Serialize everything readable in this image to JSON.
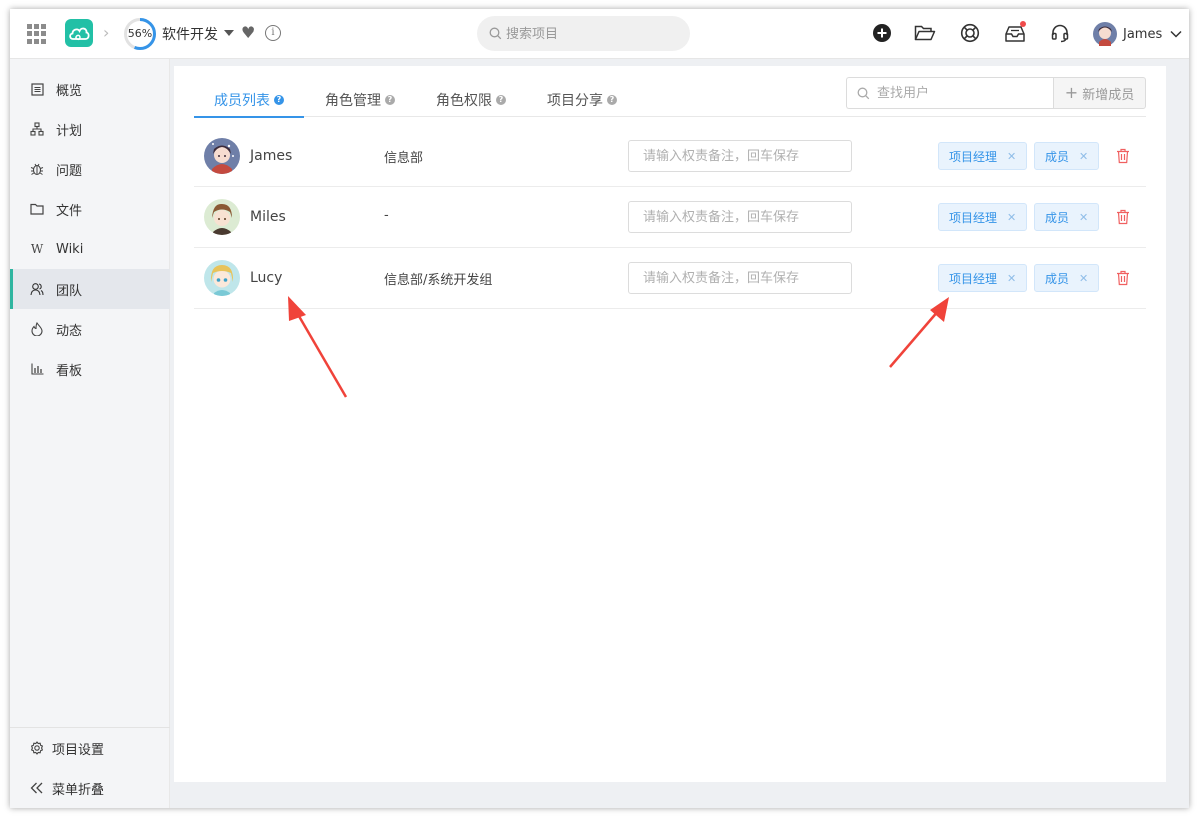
{
  "topbar": {
    "progress_label": "56%",
    "progress_value": 0.56,
    "project_name": "软件开发",
    "search_placeholder": "搜索项目",
    "user_name": "James",
    "notification_dot_color": "#f04b4b"
  },
  "sidebar": {
    "items": [
      {
        "label": "概览",
        "icon": "overview-icon"
      },
      {
        "label": "计划",
        "icon": "plan-icon"
      },
      {
        "label": "问题",
        "icon": "bug-icon"
      },
      {
        "label": "文件",
        "icon": "folder-icon"
      },
      {
        "label": "Wiki",
        "icon": "wiki-icon"
      },
      {
        "label": "团队",
        "icon": "team-icon",
        "active": true
      },
      {
        "label": "动态",
        "icon": "activity-icon"
      },
      {
        "label": "看板",
        "icon": "chart-icon"
      }
    ],
    "settings_label": "项目设置",
    "collapse_label": "菜单折叠"
  },
  "tabs": [
    {
      "label": "成员列表",
      "active": true
    },
    {
      "label": "角色管理"
    },
    {
      "label": "角色权限"
    },
    {
      "label": "项目分享"
    }
  ],
  "user_search_placeholder": "查找用户",
  "add_member_label": "新增成员",
  "members": [
    {
      "name": "James",
      "dept": "信息部",
      "note_placeholder": "请输入权责备注，回车保存",
      "roles": [
        "项目经理",
        "成员"
      ]
    },
    {
      "name": "Miles",
      "dept": "-",
      "note_placeholder": "请输入权责备注，回车保存",
      "roles": [
        "项目经理",
        "成员"
      ]
    },
    {
      "name": "Lucy",
      "dept": "信息部/系统开发组",
      "note_placeholder": "请输入权责备注，回车保存",
      "roles": [
        "项目经理",
        "成员"
      ]
    }
  ],
  "colors": {
    "accent": "#3594e8",
    "brand": "#22c0a6",
    "sidebar_active_bar": "#2fb5a0",
    "delete": "#f06060",
    "annotation_arrow": "#f0433a"
  }
}
